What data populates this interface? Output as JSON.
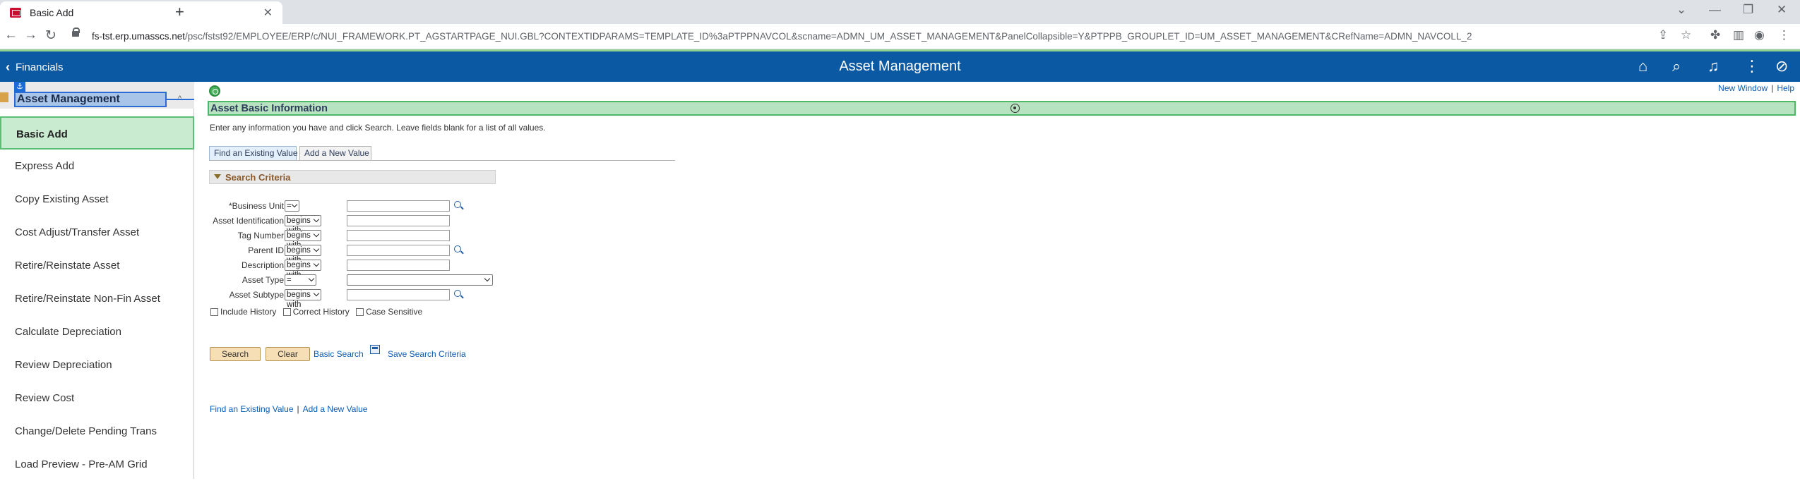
{
  "browser": {
    "tab_title": "Basic Add",
    "tab_close": "✕",
    "new_tab": "+",
    "url_host": "fs-tst.erp.umasscs.net",
    "url_path": "/psc/fstst92/EMPLOYEE/ERP/c/NUI_FRAMEWORK.PT_AGSTARTPAGE_NUI.GBL?CONTEXTIDPARAMS=TEMPLATE_ID%3aPTPPNAVCOL&scname=ADMN_UM_ASSET_MANAGEMENT&PanelCollapsible=Y&PTPPB_GROUPLET_ID=UM_ASSET_MANAGEMENT&CRefName=ADMN_NAVCOLL_2"
  },
  "header": {
    "back_label": "Financials",
    "title": "Asset Management"
  },
  "nav": {
    "heading": "Asset Management",
    "items": [
      {
        "label": "Basic Add"
      },
      {
        "label": "Express Add"
      },
      {
        "label": "Copy Existing Asset"
      },
      {
        "label": "Cost Adjust/Transfer Asset"
      },
      {
        "label": "Retire/Reinstate Asset"
      },
      {
        "label": "Retire/Reinstate Non-Fin Asset"
      },
      {
        "label": "Calculate Depreciation"
      },
      {
        "label": "Review Depreciation"
      },
      {
        "label": "Review Cost"
      },
      {
        "label": "Change/Delete Pending Trans"
      },
      {
        "label": "Load Preview - Pre-AM Grid"
      }
    ]
  },
  "content": {
    "new_window": "New Window",
    "help": "Help",
    "page_title": "Asset Basic Information",
    "instructions": "Enter any information you have and click Search. Leave fields blank for a list of all values.",
    "tabs": {
      "find": "Find an Existing Value",
      "add": "Add a New Value"
    },
    "search_criteria": "Search Criteria",
    "fields": [
      {
        "label": "*Business Unit",
        "op": "="
      },
      {
        "label": "Asset Identification",
        "op": "begins with"
      },
      {
        "label": "Tag Number",
        "op": "begins with"
      },
      {
        "label": "Parent ID",
        "op": "begins with"
      },
      {
        "label": "Description",
        "op": "begins with"
      },
      {
        "label": "Asset Type",
        "op": "="
      },
      {
        "label": "Asset Subtype",
        "op": "begins with"
      }
    ],
    "checkboxes": {
      "include_history": "Include History",
      "correct_history": "Correct History",
      "case_sensitive": "Case Sensitive"
    },
    "buttons": {
      "search": "Search",
      "clear": "Clear",
      "basic_search": "Basic Search",
      "save_search": "Save Search Criteria"
    },
    "bottom_links": {
      "find": "Find an Existing Value",
      "add": "Add a New Value"
    }
  },
  "colors": {
    "header_blue": "#0b58a3",
    "active_green": "#c9ecd1",
    "link_blue": "#0b5bb5"
  }
}
